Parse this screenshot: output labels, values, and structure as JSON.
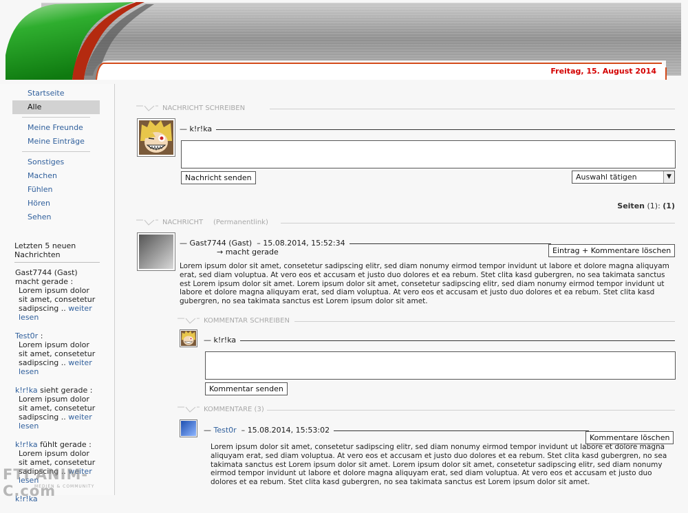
{
  "header": {
    "date": "Freitag, 15. August 2014",
    "colors": {
      "green": "#1a9a1a",
      "red": "#d40000",
      "grey": "#8a8a8a"
    }
  },
  "sidebar": {
    "groups": [
      [
        {
          "label": "Startseite",
          "active": false
        },
        {
          "label": "Alle",
          "active": true
        }
      ],
      [
        {
          "label": "Meine Freunde",
          "active": false
        },
        {
          "label": "Meine Einträge",
          "active": false
        }
      ],
      [
        {
          "label": "Sonstiges",
          "active": false
        },
        {
          "label": "Machen",
          "active": false
        },
        {
          "label": "Fühlen",
          "active": false
        },
        {
          "label": "Hören",
          "active": false
        },
        {
          "label": "Sehen",
          "active": false
        }
      ]
    ],
    "recent_title": "Letzten 5 neuen Nachrichten",
    "recent": [
      {
        "user": "Gast7744 (Gast)",
        "verb": "macht gerade :",
        "text": "Lorem ipsum dolor sit amet, consetetur sadipscing",
        "more": "weiter lesen"
      },
      {
        "user": "Test0r",
        "verb": ":",
        "text": "Lorem ipsum dolor sit amet, consetetur sadipscing",
        "more": "weiter lesen"
      },
      {
        "user": "k!r!ka",
        "verb": "sieht gerade :",
        "text": "Lorem ipsum dolor sit amet, consetetur sadipscing",
        "more": "weiter lesen"
      },
      {
        "user": "k!r!ka",
        "verb": "fühlt gerade :",
        "text": "Lorem ipsum dolor sit amet, consetetur sadipscing",
        "more": "weiter lesen"
      },
      {
        "user": "k!r!ka",
        "verb": "",
        "text": "",
        "more": ""
      }
    ],
    "watermark": {
      "logo": "FTI",
      "site": "ANIM-C.com",
      "tagline": "MEDIEN & COMMUNITY"
    }
  },
  "compose": {
    "title": "NACHRICHT SCHREIBEN",
    "user": "k!r!ka",
    "send_label": "Nachricht senden",
    "select_value": "Auswahl tätigen"
  },
  "pages": {
    "label": "Seiten",
    "count": "(1):",
    "current": "(1)"
  },
  "message": {
    "title": "NACHRICHT",
    "permalink": "(Permanentlink)",
    "user": "Gast7744 (Gast)",
    "timestamp": "15.08.2014, 15:52:34",
    "activity": "→ macht gerade",
    "delete_label": "Eintrag + Kommentare löschen",
    "text": "Lorem ipsum dolor sit amet, consetetur sadipscing elitr, sed diam nonumy eirmod tempor invidunt ut labore et dolore magna aliquyam erat, sed diam voluptua. At vero eos et accusam et justo duo dolores et ea rebum. Stet clita kasd gubergren, no sea takimata sanctus est Lorem ipsum dolor sit amet. Lorem ipsum dolor sit amet, consetetur sadipscing elitr, sed diam nonumy eirmod tempor invidunt ut labore et dolore magna aliquyam erat, sed diam voluptua. At vero eos et accusam et justo duo dolores et ea rebum. Stet clita kasd gubergren, no sea takimata sanctus est Lorem ipsum dolor sit amet."
  },
  "comment_compose": {
    "title": "KOMMENTAR SCHREIBEN",
    "user": "k!r!ka",
    "send_label": "Kommentar senden"
  },
  "comments": {
    "title": "KOMMENTARE (3)",
    "items": [
      {
        "user": "Test0r",
        "timestamp": "15.08.2014, 15:53:02",
        "delete_label": "Kommentare löschen",
        "text": "Lorem ipsum dolor sit amet, consetetur sadipscing elitr, sed diam nonumy eirmod tempor invidunt ut labore et dolore magna aliquyam erat, sed diam voluptua. At vero eos et accusam et justo duo dolores et ea rebum. Stet clita kasd gubergren, no sea takimata sanctus est Lorem ipsum dolor sit amet. Lorem ipsum dolor sit amet, consetetur sadipscing elitr, sed diam nonumy eirmod tempor invidunt ut labore et dolore magna aliquyam erat, sed diam voluptua. At vero eos et accusam et justo duo dolores et ea rebum. Stet clita kasd gubergren, no sea takimata sanctus est Lorem ipsum dolor sit amet."
      }
    ]
  }
}
